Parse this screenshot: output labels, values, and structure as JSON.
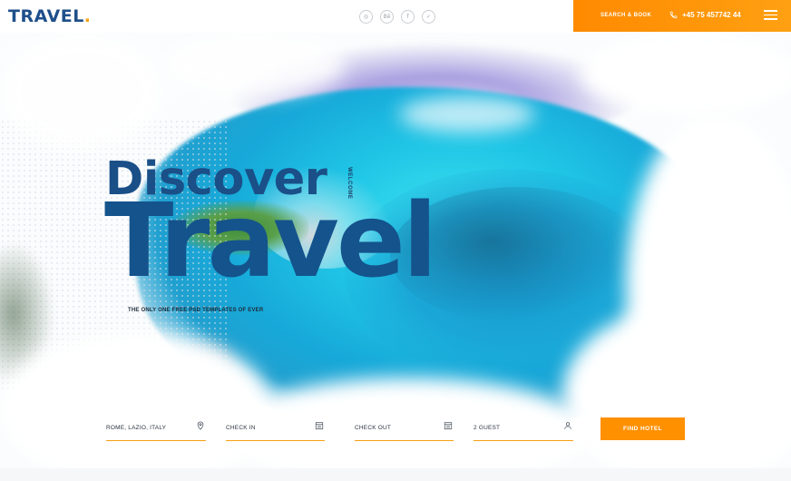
{
  "brand": {
    "name": "TRAVEL",
    "dot": "."
  },
  "header": {
    "social": [
      {
        "icon": "dribbble-icon",
        "glyph": "◎"
      },
      {
        "icon": "behance-icon",
        "glyph": "Bē"
      },
      {
        "icon": "facebook-icon",
        "glyph": "f"
      },
      {
        "icon": "twitter-icon",
        "glyph": "✓"
      }
    ],
    "search_book": "SEARCH & BOOK",
    "phone": "+45 75 457742 44",
    "menu_icon": "hamburger-menu-icon"
  },
  "hero": {
    "line1": "Discover",
    "line2": "Travel",
    "side_label": "WELCOME",
    "tagline": "THE ONLY ONE FREE PSD TEMPLATES OF EVER"
  },
  "search": {
    "location": "ROME, LAZIO, ITALY",
    "check_in": "CHECK IN",
    "check_out": "CHECK OUT",
    "guests": "2 GUEST",
    "button": "FIND HOTEL"
  },
  "colors": {
    "brand_blue": "#1a4f87",
    "accent_orange": "#ff9000",
    "logo_dot": "#f7a011"
  }
}
